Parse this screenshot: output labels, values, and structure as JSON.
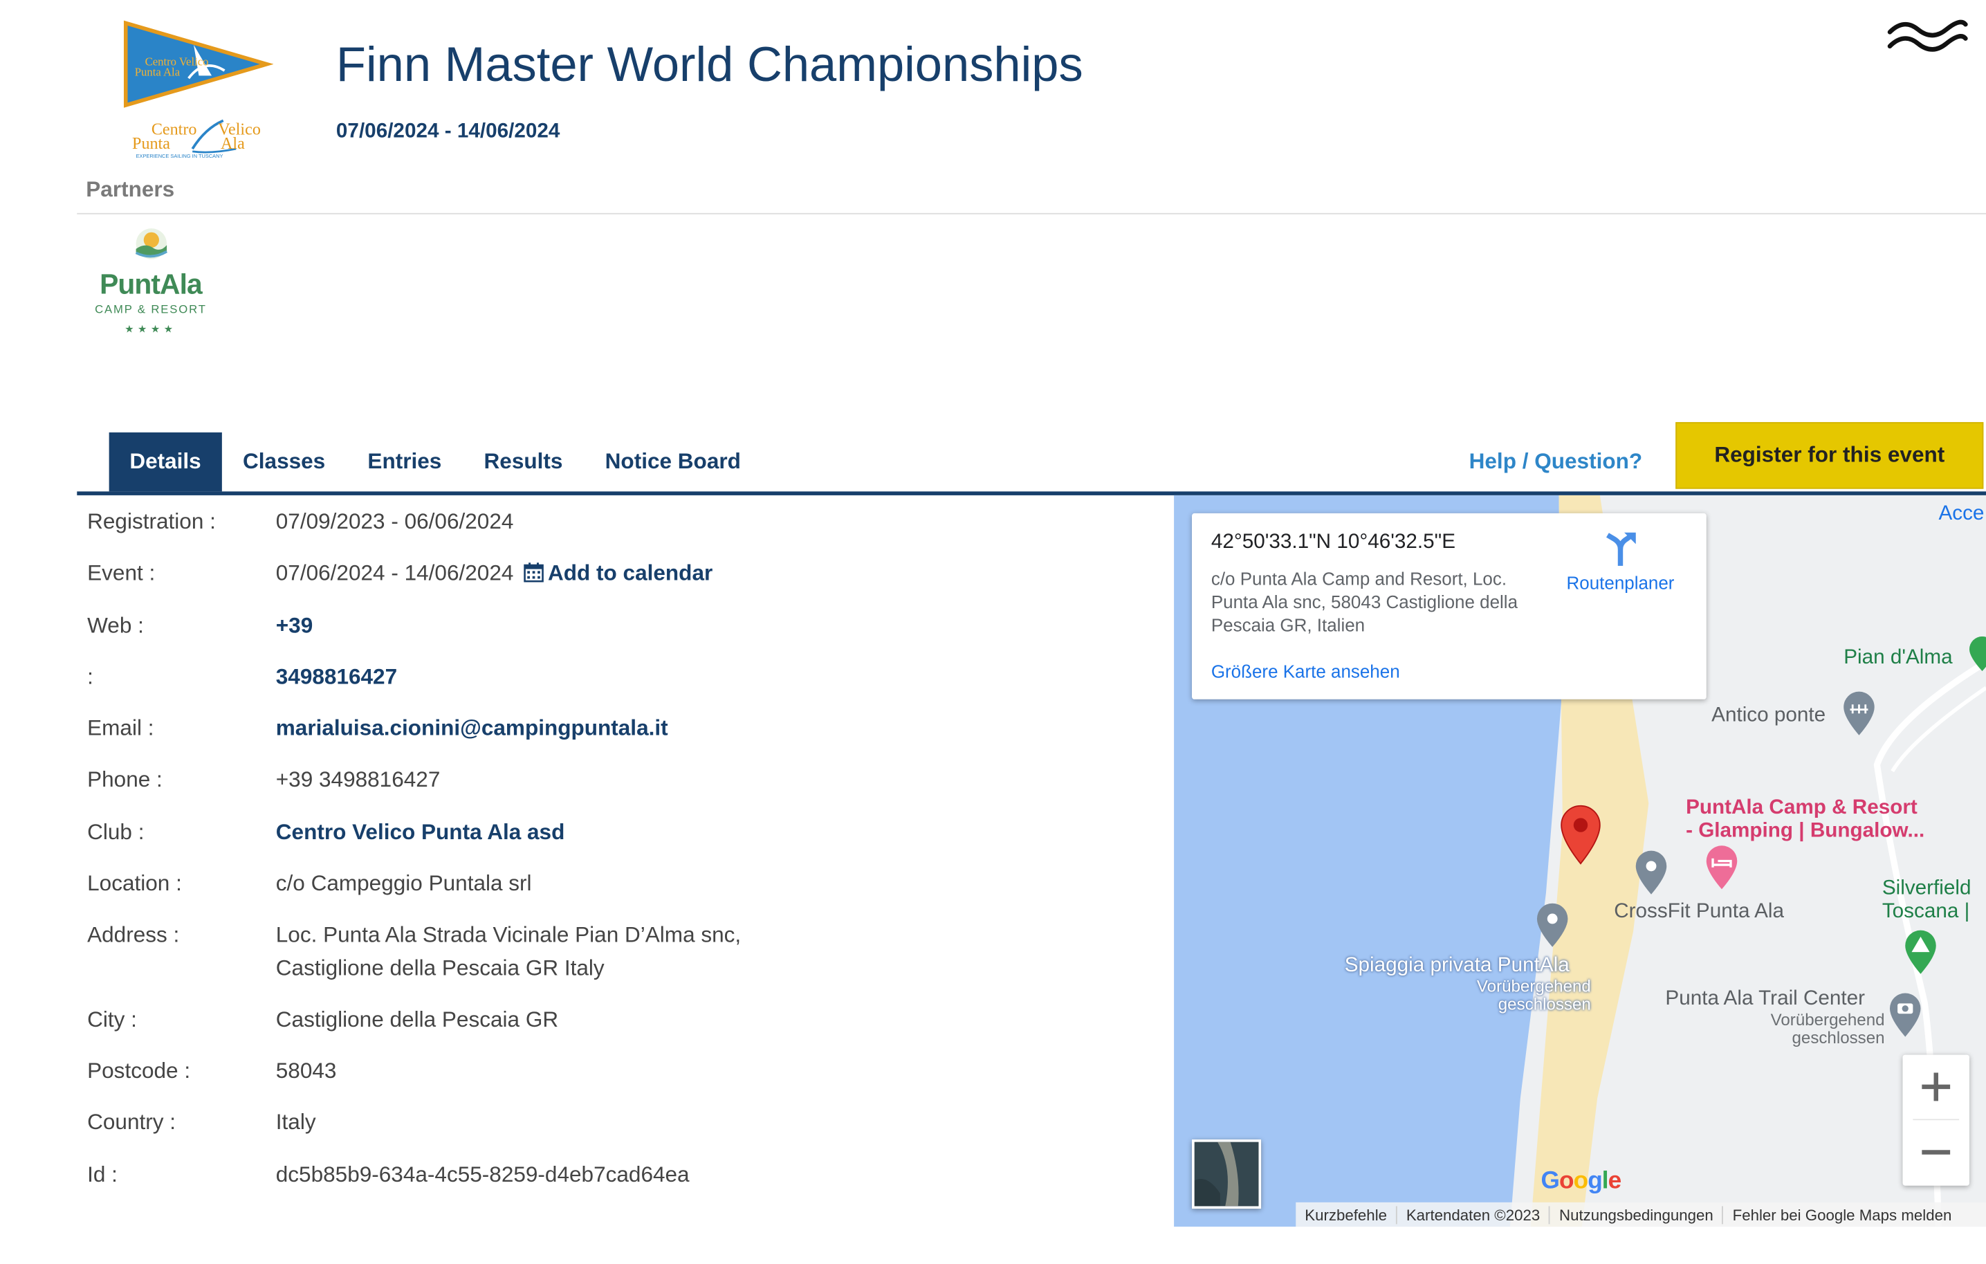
{
  "header": {
    "club_logo_text": "Centro Velico Punta Ala",
    "club_tagline": "EXPERIENCE SAILING IN TUSCANY",
    "title": "Finn Master World Championships",
    "dates": "07/06/2024 - 14/06/2024"
  },
  "partners": {
    "label": "Partners",
    "logo_name": "PuntAla",
    "logo_sub": "CAMP & RESORT",
    "logo_stars": "★★★★"
  },
  "tabs": [
    {
      "label": "Details",
      "active": true
    },
    {
      "label": "Classes",
      "active": false
    },
    {
      "label": "Entries",
      "active": false
    },
    {
      "label": "Results",
      "active": false
    },
    {
      "label": "Notice Board",
      "active": false
    }
  ],
  "help_link": "Help / Question?",
  "register_button": "Register for this event",
  "details": {
    "registration": {
      "label": "Registration :",
      "value": "07/09/2023 - 06/06/2024"
    },
    "event": {
      "label": "Event :",
      "value": "07/06/2024 - 14/06/2024",
      "calendar_link": "Add to calendar"
    },
    "web": {
      "label": "Web :",
      "value": "+39"
    },
    "blank": {
      "label": ":",
      "value": "3498816427"
    },
    "email": {
      "label": "Email :",
      "value": "marialuisa.cionini@campingpuntala.it"
    },
    "phone": {
      "label": "Phone :",
      "value": "+39 3498816427"
    },
    "club": {
      "label": "Club :",
      "value": "Centro Velico Punta Ala asd"
    },
    "location": {
      "label": "Location :",
      "value": "c/o Campeggio Puntala srl"
    },
    "address": {
      "label": "Address :",
      "line1": "Loc. Punta Ala Strada Vicinale Pian D’Alma snc,",
      "line2": "Castiglione della Pescaia GR Italy"
    },
    "city": {
      "label": "City :",
      "value": "Castiglione della Pescaia GR"
    },
    "postcode": {
      "label": "Postcode :",
      "value": "58043"
    },
    "country": {
      "label": "Country :",
      "value": "Italy"
    },
    "id": {
      "label": "Id :",
      "value": "dc5b85b9-634a-4c55-8259-d4eb7cad64ea"
    }
  },
  "map": {
    "coordinates": "42°50'33.1\"N 10°46'32.5\"E",
    "address": "c/o Punta Ala Camp and Resort, Loc. Punta Ala snc, 58043 Castiglione della Pescaia GR, Italien",
    "bigger_map": "Größere Karte ansehen",
    "route_planner": "Routenplaner",
    "acce": "Acce",
    "labels": {
      "pian_dalma": "Pian d'Alma",
      "antico_ponte": "Antico ponte",
      "puntala_camp_1": "PuntAla Camp & Resort",
      "puntala_camp_2": "- Glamping | Bungalow...",
      "crossfit": "CrossFit Punta Ala",
      "silverfield_1": "Silverfield",
      "silverfield_2": "Toscana |",
      "beach": "Spiaggia privata PuntAla",
      "beach_sub_1": "Vorübergehend",
      "beach_sub_2": "geschlossen",
      "trail": "Punta Ala Trail Center",
      "trail_sub_1": "Vorübergehend",
      "trail_sub_2": "geschlossen"
    },
    "google": "Google",
    "footer": [
      "Kurzbefehle",
      "Kartendaten ©2023",
      "Nutzungsbedingungen",
      "Fehler bei Google Maps melden"
    ]
  }
}
